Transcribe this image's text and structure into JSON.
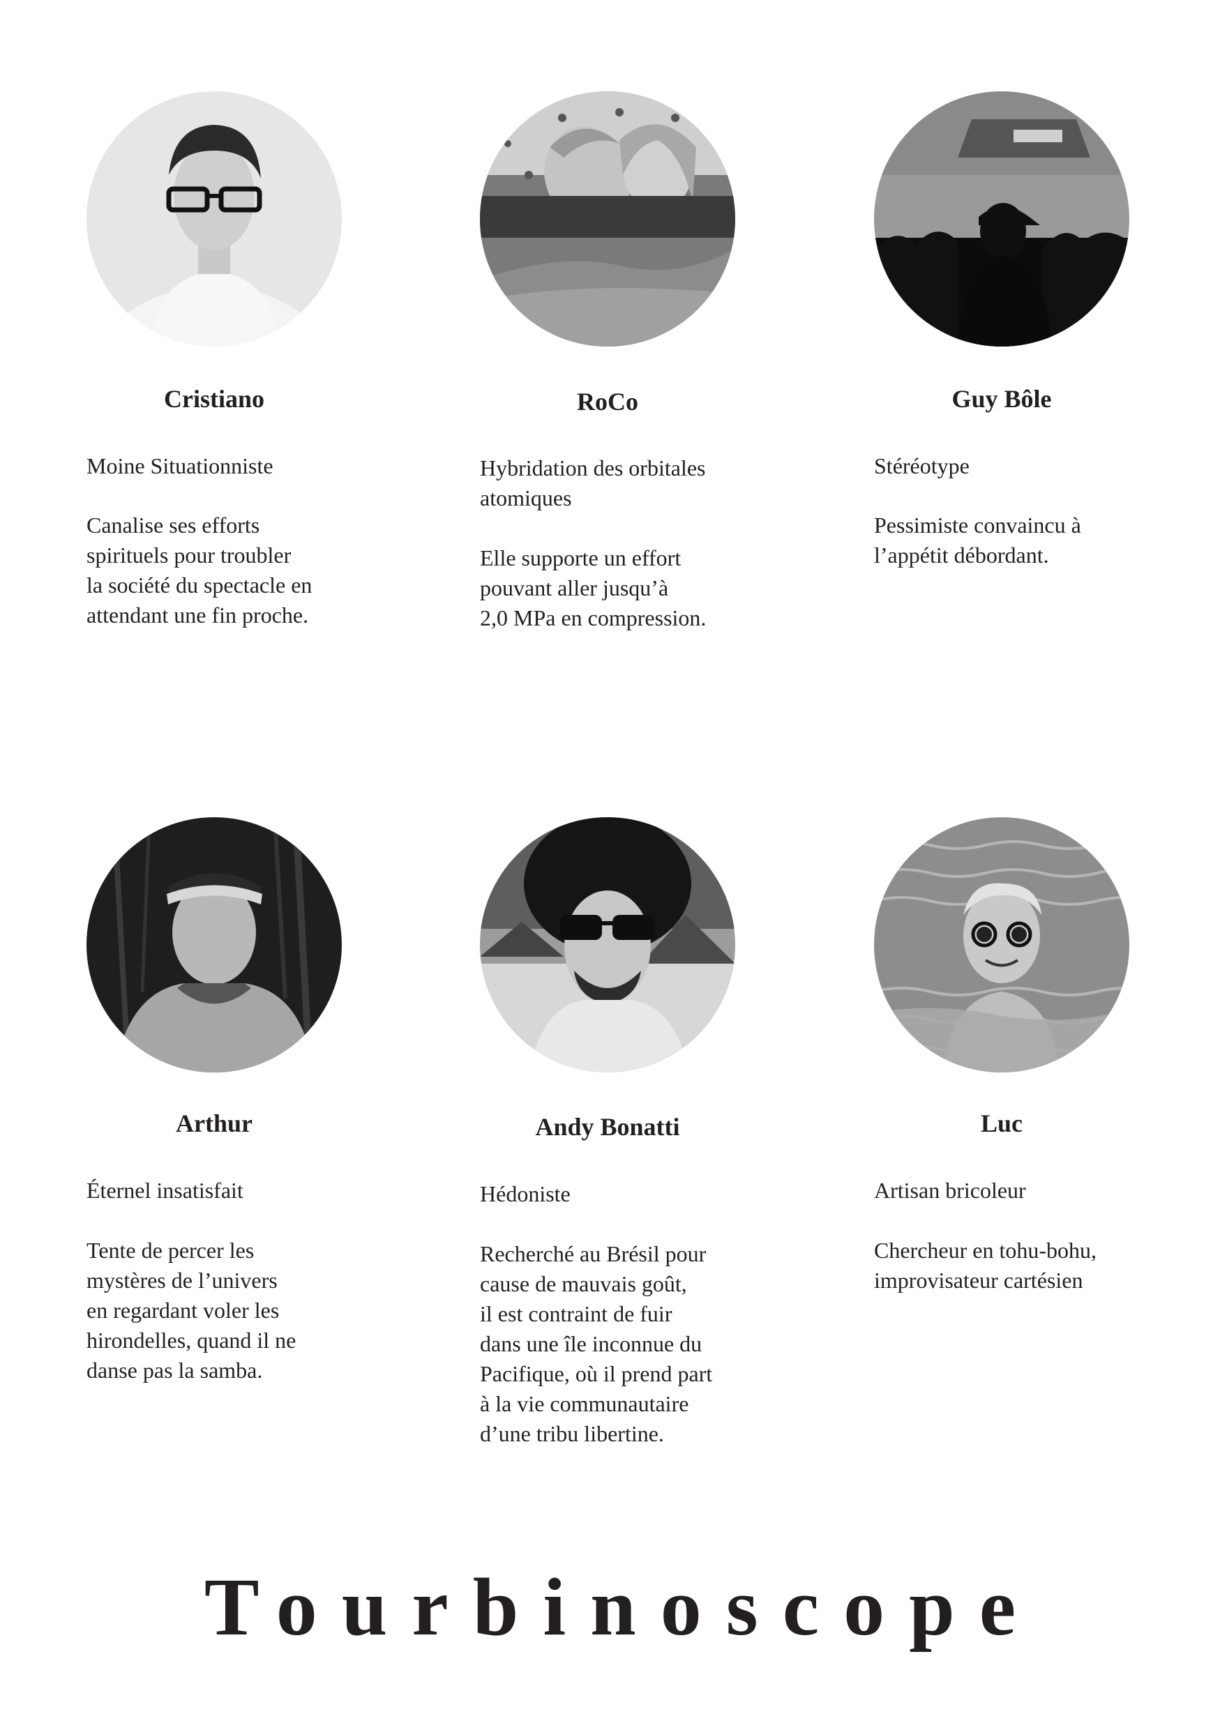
{
  "members": [
    {
      "name": "Cristiano",
      "role": "Moine Situationniste",
      "description": "Canalise ses efforts\nspirituels pour troubler\nla société du spectacle en\nattendant une fin proche."
    },
    {
      "name": "RoCo",
      "role": "Hybridation des orbitales\natomiques",
      "description": "Elle supporte un effort\npouvant aller jusqu’à\n2,0 MPa en compression."
    },
    {
      "name": "Guy Bôle",
      "role": "Stéréotype",
      "description": "Pessimiste convaincu à\nl’appétit débordant."
    },
    {
      "name": "Arthur",
      "role": "Éternel insatisfait",
      "description": "Tente de percer les\nmystères de l’univers\nen regardant voler les\nhirondelles, quand il ne\ndanse pas la samba."
    },
    {
      "name": "Andy Bonatti",
      "role": "Hédoniste",
      "description": "Recherché au Brésil pour\ncause de mauvais goût,\nil est contraint de fuir\ndans une île inconnue du\nPacifique, où il prend part\nà la vie communautaire\nd’une tribu libertine."
    },
    {
      "name": "Luc",
      "role": "Artisan bricoleur",
      "description": "Chercheur en tohu-bohu,\nimprovisateur cartésien"
    }
  ],
  "title": "Tourbinoscope"
}
